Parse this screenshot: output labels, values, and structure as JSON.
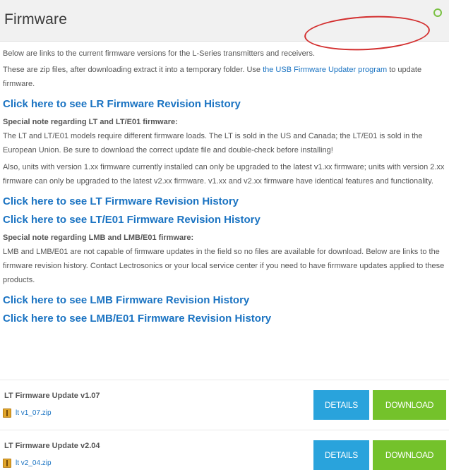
{
  "header": {
    "title": "Firmware",
    "collapse_icon": "circle-icon"
  },
  "intro": {
    "line1": "Below are links to the current firmware versions for the L-Series transmitters and receivers.",
    "line2_prefix": "These are zip files, after downloading extract it into a temporary folder. Use ",
    "updater_link": "the USB Firmware Updater program",
    "line2_suffix": " to update firmware."
  },
  "links": {
    "lr_history": "Click here to see LR Firmware Revision History",
    "lt_history": "Click here to see LT Firmware Revision History",
    "lte01_history": "Click here to see LT/E01 Firmware Revision History",
    "lmb_history": "Click here to see LMB Firmware Revision History",
    "lmbe01_history": "Click here to see LMB/E01 Firmware Revision History"
  },
  "lt_note": {
    "heading": "Special note regarding LT and LT/E01 firmware:",
    "body": "The LT and LT/E01 models require different firmware loads. The LT is sold in the US and Canada; the LT/E01 is sold in the European Union. Be sure to download the correct update file and double-check before installing!",
    "body2": "Also, units with version 1.xx firmware currently installed can only be upgraded to the latest v1.xx firmware; units with version 2.xx firmware can only be upgraded to the latest v2.xx firmware. v1.xx and v2.xx firmware have identical features and functionality."
  },
  "lmb_note": {
    "heading": "Special note regarding LMB and LMB/E01 firmware:",
    "body": "LMB and LMB/E01 are not capable of firmware updates in the field so no files are available for download. Below are links to the firmware revision history. Contact Lectrosonics or your local service center if you need to have firmware updates applied to these products."
  },
  "downloads": [
    {
      "title": "LT Firmware Update v1.07",
      "file": "lt v1_07.zip",
      "file_icon": "zip-file-icon",
      "details_label": "DETAILS",
      "download_label": "DOWNLOAD"
    },
    {
      "title": "LT Firmware Update v2.04",
      "file": "lt v2_04.zip",
      "file_icon": "zip-file-icon",
      "details_label": "DETAILS",
      "download_label": "DOWNLOAD"
    }
  ],
  "colors": {
    "link": "#1a73c2",
    "details_button": "#29a3dc",
    "download_button": "#74c22b",
    "highlight_ring": "#d32f2f"
  }
}
